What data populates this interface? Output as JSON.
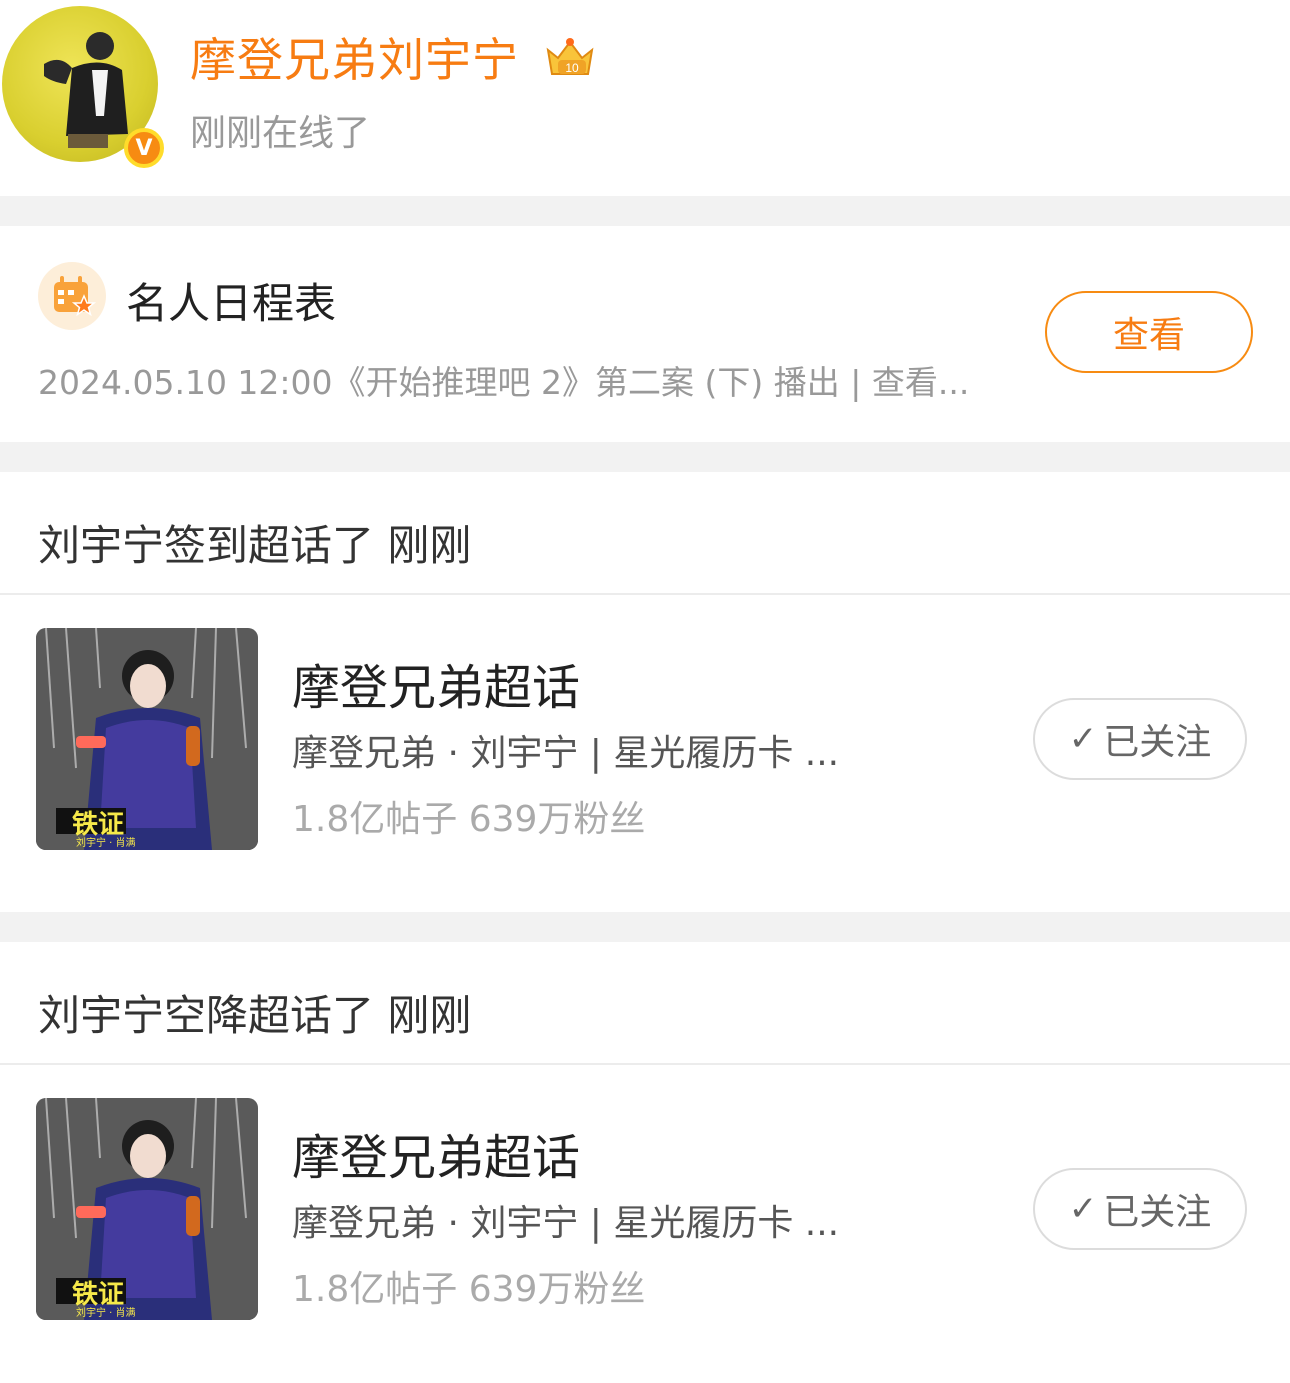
{
  "profile": {
    "name": "摩登兄弟刘宇宁",
    "status": "刚刚在线了",
    "avatar_icon": "user-avatar-icon",
    "verified_badge": "V",
    "crown_level": "10"
  },
  "schedule": {
    "title": "名人日程表",
    "description": "2024.05.10 12:00《开始推理吧 2》第二案 (下) 播出 |  查看...",
    "button_label": "查看",
    "icon": "calendar-star-icon"
  },
  "activities": [
    {
      "header": "刘宇宁签到超话了 刚刚",
      "topic": {
        "title": "摩登兄弟超话",
        "subtitle": "摩登兄弟 · 刘宇宁 | 星光履历卡 ...",
        "stats": "1.8亿帖子   639万粉丝",
        "cover_caption": "铁证",
        "cover_sub": "刘宇宁 · 肖满"
      },
      "follow_label": "已关注"
    },
    {
      "header": "刘宇宁空降超话了 刚刚",
      "topic": {
        "title": "摩登兄弟超话",
        "subtitle": "摩登兄弟 · 刘宇宁 | 星光履历卡 ...",
        "stats": "1.8亿帖子   639万粉丝",
        "cover_caption": "铁证",
        "cover_sub": "刘宇宁 · 肖满"
      },
      "follow_label": "已关注"
    }
  ],
  "colors": {
    "accent": "#f77c12",
    "muted_text": "#999999",
    "separator": "#f2f2f2"
  }
}
